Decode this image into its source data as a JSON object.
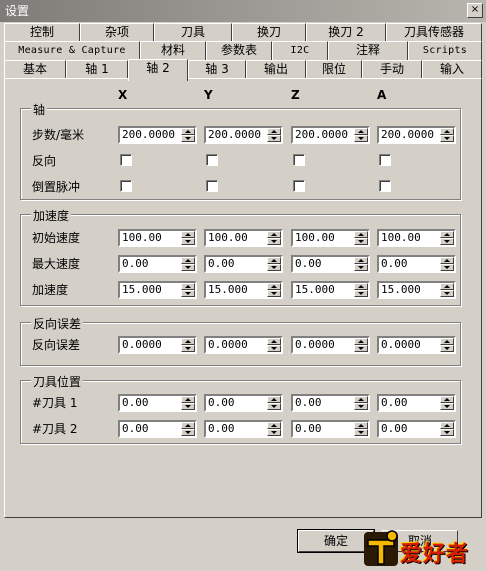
{
  "window": {
    "title": "设置",
    "close_glyph": "×"
  },
  "tabs": {
    "row1": [
      "控制",
      "杂项",
      "刀具",
      "换刀",
      "换刀 2",
      "刀具传感器"
    ],
    "row2": [
      "Measure & Capture",
      "材料",
      "参数表",
      "I2C",
      "注释",
      "Scripts"
    ],
    "row3": [
      "基本",
      "轴 1",
      "轴 2",
      "轴 3",
      "输出",
      "限位",
      "手动",
      "输入"
    ],
    "active": "轴 2"
  },
  "columns": [
    "X",
    "Y",
    "Z",
    "A"
  ],
  "axis_group": {
    "title": "轴",
    "steps_label": "步数/毫米",
    "steps_values": [
      "200.0000",
      "200.0000",
      "200.0000",
      "200.0000"
    ],
    "reverse_label": "反向",
    "reverse_checked": [
      false,
      false,
      false,
      false
    ],
    "invert_pulse_label": "倒置脉冲",
    "invert_pulse_checked": [
      false,
      false,
      false,
      false
    ]
  },
  "accel_group": {
    "title": "加速度",
    "initial_speed_label": "初始速度",
    "initial_speed_values": [
      "100.00",
      "100.00",
      "100.00",
      "100.00"
    ],
    "max_speed_label": "最大速度",
    "max_speed_values": [
      "0.00",
      "0.00",
      "0.00",
      "0.00"
    ],
    "accel_label": "加速度",
    "accel_values": [
      "15.000",
      "15.000",
      "15.000",
      "15.000"
    ]
  },
  "backlash_group": {
    "title": "反向误差",
    "backlash_label": "反向误差",
    "backlash_values": [
      "0.0000",
      "0.0000",
      "0.0000",
      "0.0000"
    ]
  },
  "tool_group": {
    "title": "刀具位置",
    "tool1_label": "#刀具 1",
    "tool1_values": [
      "0.00",
      "0.00",
      "0.00",
      "0.00"
    ],
    "tool2_label": "#刀具 2",
    "tool2_values": [
      "0.00",
      "0.00",
      "0.00",
      "0.00"
    ]
  },
  "buttons": {
    "ok": "确定",
    "cancel": "取消"
  },
  "watermark": {
    "text": "爱好者"
  }
}
